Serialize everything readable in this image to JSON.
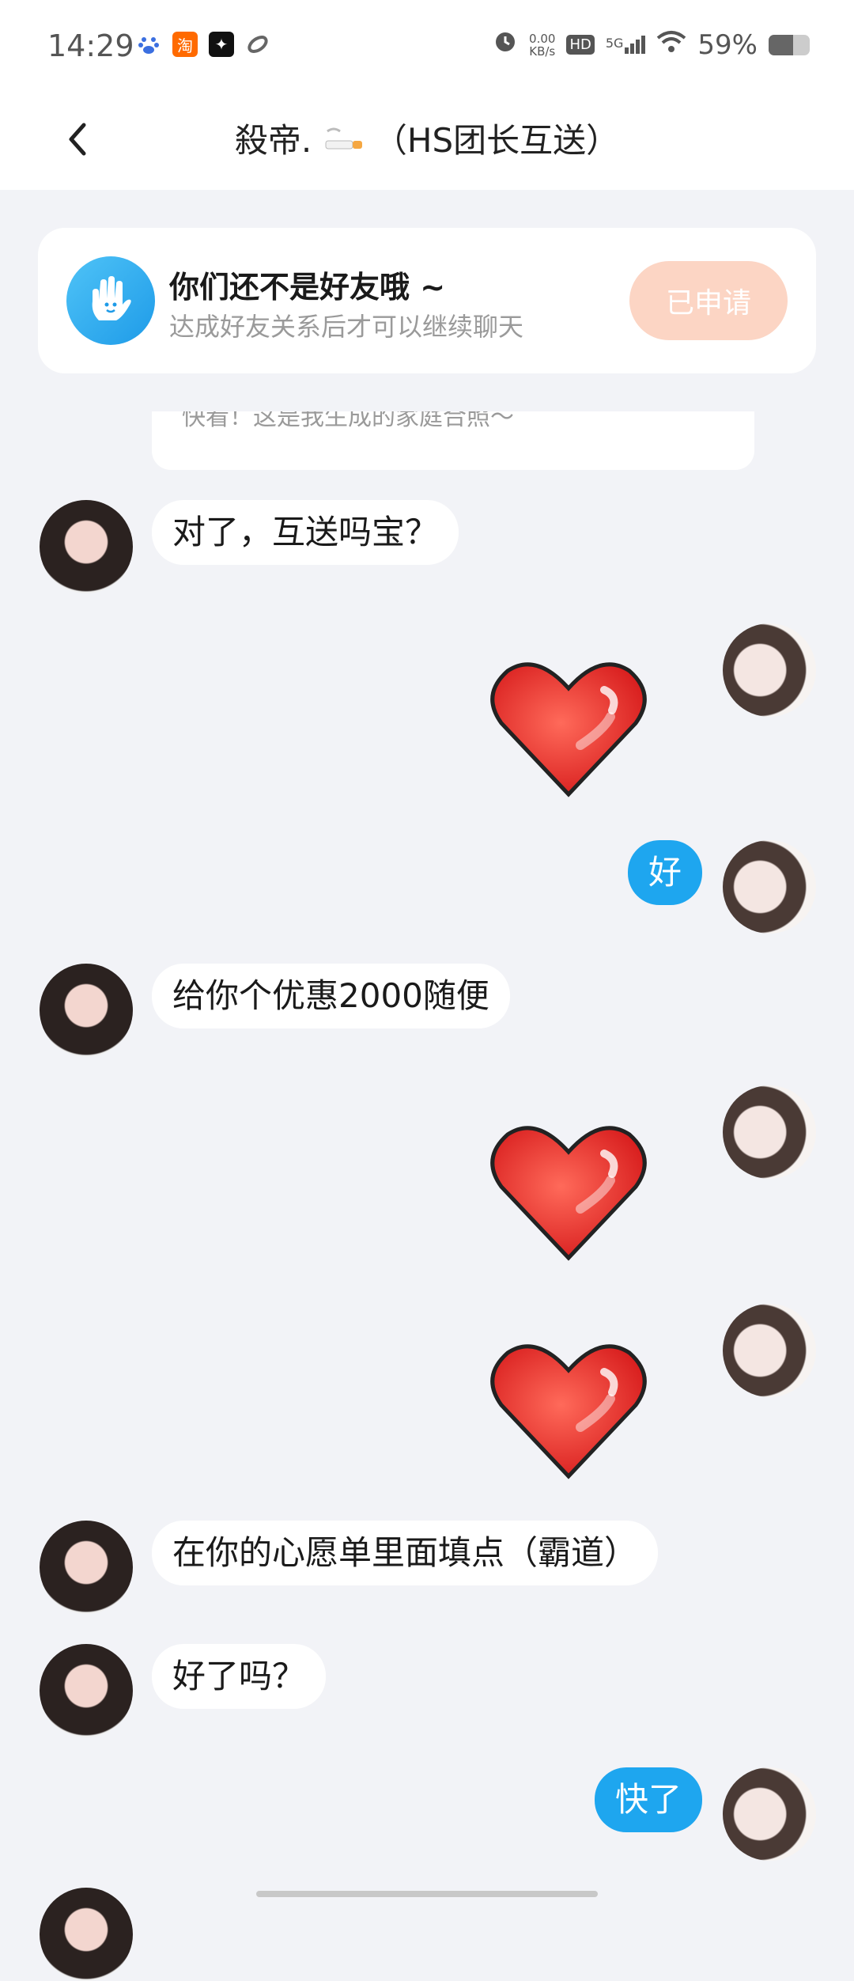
{
  "status_bar": {
    "time": "14:29",
    "net_speed_value": "0.00",
    "net_speed_unit": "KB/s",
    "hd": "HD",
    "network": "5G",
    "battery_percent": "59%",
    "battery_level": 0.59,
    "app_icons": [
      "baidu-icon",
      "taobao-icon",
      "sparkle-app-icon",
      "link-app-icon"
    ],
    "taobao_glyph": "淘"
  },
  "header": {
    "title_prefix": "殺帝.",
    "title_suffix": "（HS团长互送）"
  },
  "notice": {
    "title": "你们还不是好友哦 ~",
    "subtitle": "达成好友关系后才可以继续聊天",
    "button_label": "已申请"
  },
  "partial_card": {
    "text": "快看！这是我生成的家庭合照～"
  },
  "messages": [
    {
      "side": "in",
      "type": "text",
      "text": "对了，互送吗宝？"
    },
    {
      "side": "out",
      "type": "sticker",
      "sticker": "heart-sticker"
    },
    {
      "side": "out",
      "type": "text",
      "text": "好"
    },
    {
      "side": "in",
      "type": "text",
      "text": "给你个优惠2000随便"
    },
    {
      "side": "out",
      "type": "sticker",
      "sticker": "heart-sticker"
    },
    {
      "side": "out",
      "type": "sticker",
      "sticker": "heart-sticker"
    },
    {
      "side": "in",
      "type": "text",
      "text": "在你的心愿单里面填点（霸道）"
    },
    {
      "side": "in",
      "type": "text",
      "text": "好了吗？"
    },
    {
      "side": "out",
      "type": "text",
      "text": "快了"
    }
  ],
  "colors": {
    "outgoing_bubble": "#1ea6ef",
    "applied_button": "#fcd5c4",
    "background": "#f2f3f7"
  }
}
